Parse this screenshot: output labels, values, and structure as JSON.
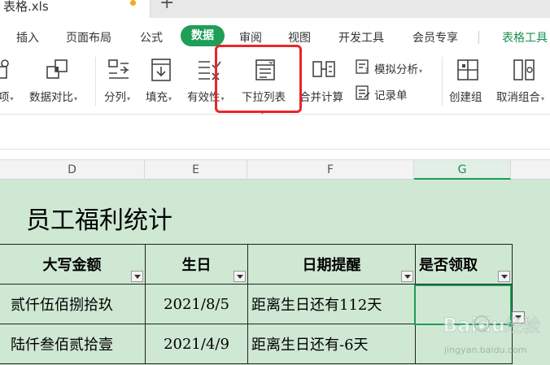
{
  "file_tab": {
    "name": "表格.xls",
    "new_tab": "+"
  },
  "menu": {
    "items": [
      "插入",
      "页面布局",
      "公式",
      "数据",
      "审阅",
      "视图",
      "开发工具",
      "会员专享",
      "表格工具"
    ],
    "active": "数据",
    "active_color": "#1e9e57"
  },
  "toolbar": {
    "tools": [
      {
        "label": "项",
        "caret": "▾",
        "icon": "partial-icon"
      },
      {
        "label": "数据对比",
        "caret": "▾",
        "icon": "data-compare-icon"
      },
      {
        "label": "分列",
        "caret": "▾",
        "icon": "split-column-icon"
      },
      {
        "label": "填充",
        "caret": "▾",
        "icon": "fill-icon"
      },
      {
        "label": "有效性",
        "caret": "▾",
        "icon": "validity-icon"
      },
      {
        "label": "下拉列表",
        "icon": "dropdown-list-icon"
      },
      {
        "label": "合并计算",
        "icon": "merge-calc-icon"
      },
      {
        "label": "模拟分析",
        "caret": "▾",
        "icon": "what-if-icon"
      },
      {
        "label": "记录单",
        "icon": "record-form-icon"
      },
      {
        "label": "创建组",
        "icon": "create-group-icon"
      },
      {
        "label": "取消组合",
        "caret": "▾",
        "icon": "ungroup-icon"
      }
    ],
    "highlighted": "下拉列表",
    "highlight_color": "#e8262b"
  },
  "columns": [
    "D",
    "E",
    "F",
    "G"
  ],
  "selected_column": "G",
  "sheet": {
    "title": "员工福利统计",
    "headers": [
      "大写金额",
      "生日",
      "日期提醒",
      "是否领取"
    ],
    "rows": [
      [
        "贰仟伍佰捌拾玖",
        "2021/8/5",
        "距离生日还有112天",
        ""
      ],
      [
        "陆仟叁佰贰拾壹",
        "2021/4/9",
        "距离生日还有-6天",
        ""
      ]
    ],
    "background": "#cfe8d3"
  },
  "watermark": {
    "brand": "Baidu",
    "text": "经验",
    "sub": "jingyan.baidu.com"
  }
}
